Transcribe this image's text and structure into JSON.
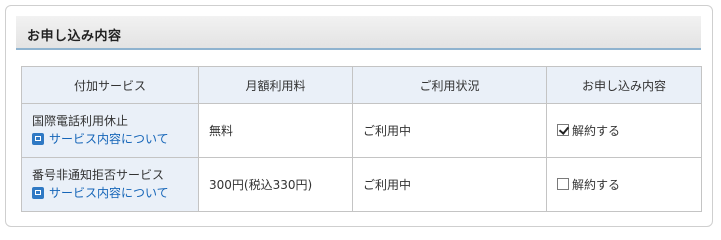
{
  "section": {
    "title": "お申し込み内容"
  },
  "table": {
    "headers": [
      "付加サービス",
      "月額利用料",
      "ご利用状況",
      "お申し込み内容"
    ],
    "rows": [
      {
        "service_name": "国際電話利用休止",
        "link_label": "サービス内容について",
        "fee": "無料",
        "status": "ご利用中",
        "action_label": "解約する",
        "checked": true
      },
      {
        "service_name": "番号非通知拒否サービス",
        "link_label": "サービス内容について",
        "fee": "300円(税込330円)",
        "status": "ご利用中",
        "action_label": "解約する",
        "checked": false
      }
    ]
  },
  "colors": {
    "header_bg": "#eaf0f8",
    "link": "#1565b8",
    "title_underline": "#8fb3cf"
  }
}
